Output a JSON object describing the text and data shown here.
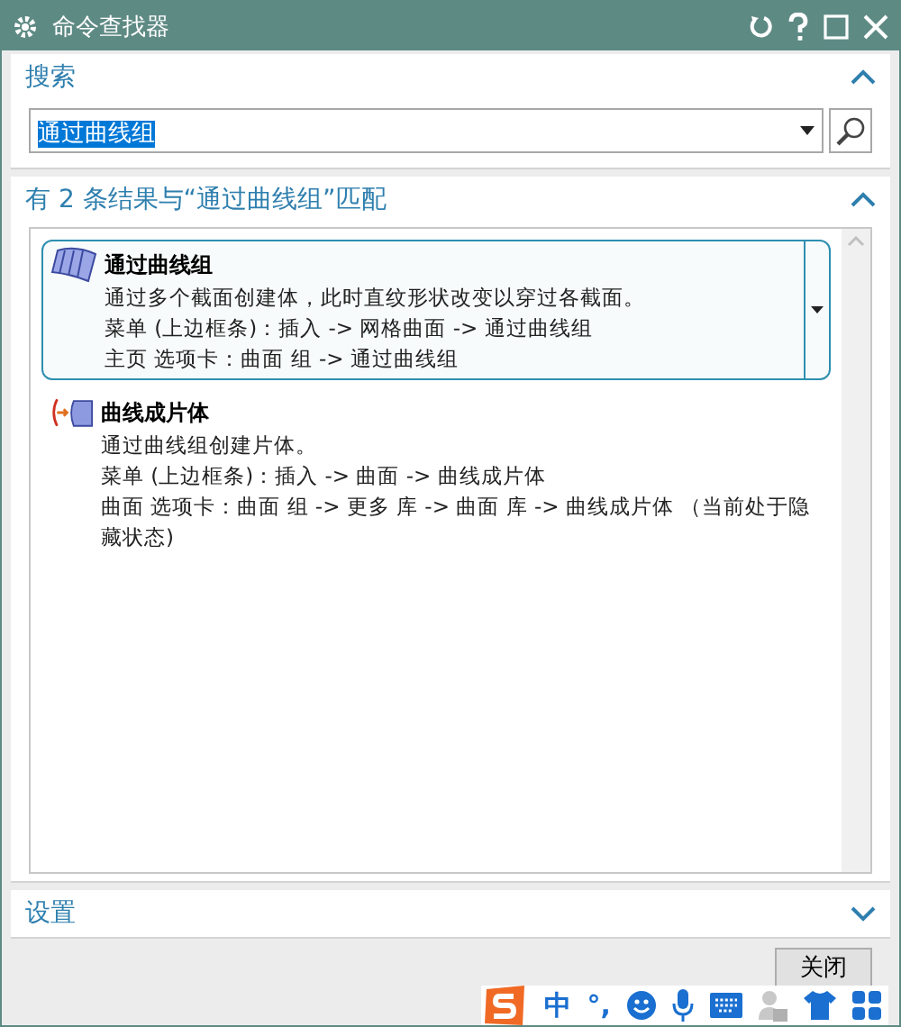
{
  "window": {
    "title": "命令查找器"
  },
  "search_section": {
    "title": "搜索",
    "expanded": true,
    "value": "通过曲线组"
  },
  "results_section": {
    "title": "有 2 条结果与“通过曲线组”匹配",
    "expanded": true,
    "results": [
      {
        "kind": "ruled",
        "selected": true,
        "name": "通过曲线组",
        "lines": [
          "通过多个截面创建体，此时直纹形状改变以穿过各截面。",
          "菜单 (上边框条)：插入 -> 网格曲面 -> 通过曲线组",
          "主页 选项卡：曲面 组 -> 通过曲线组"
        ]
      },
      {
        "kind": "sheet",
        "selected": false,
        "name": "曲线成片体",
        "lines": [
          "通过曲线组创建片体。",
          "菜单 (上边框条)：插入 -> 曲面 -> 曲线成片体",
          "曲面 选项卡：曲面 组 -> 更多 库 -> 曲面 库 -> 曲线成片体 （当前处于隐藏状态)"
        ]
      }
    ]
  },
  "settings_section": {
    "title": "设置",
    "expanded": false
  },
  "buttons": [
    "关闭"
  ],
  "ime_bar": {
    "mode": "中",
    "punctuation": "°,"
  }
}
